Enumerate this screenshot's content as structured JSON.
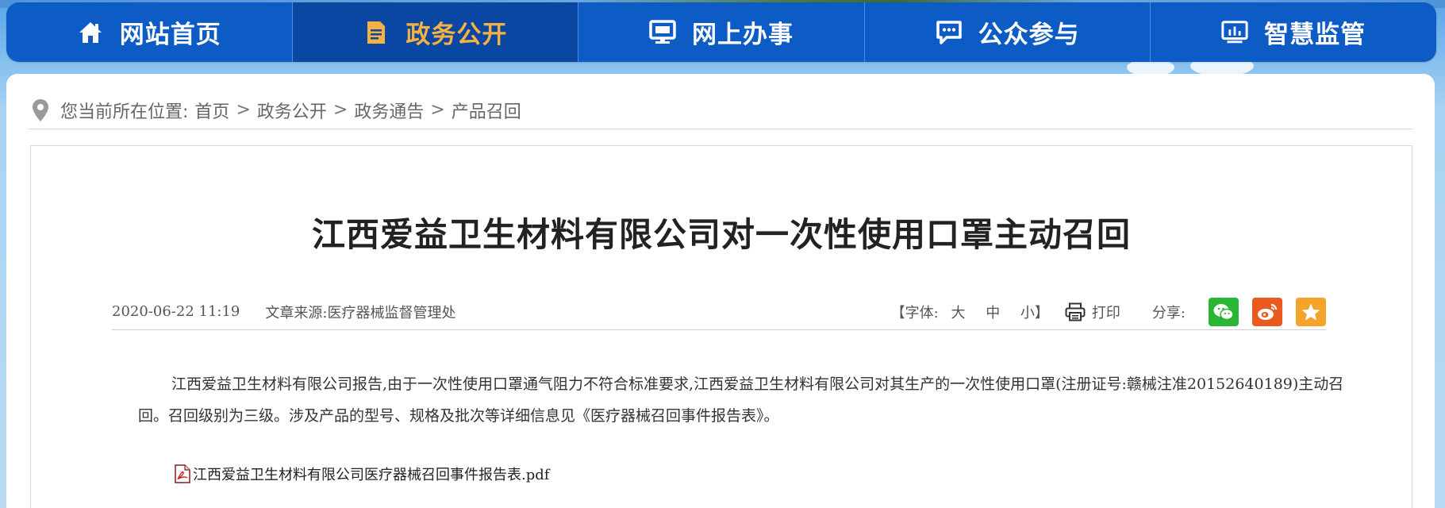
{
  "nav": {
    "items": [
      {
        "label": "网站首页",
        "icon": "home-icon"
      },
      {
        "label": "政务公开",
        "icon": "document-icon",
        "active": true
      },
      {
        "label": "网上办事",
        "icon": "monitor-icon"
      },
      {
        "label": "公众参与",
        "icon": "chat-icon"
      },
      {
        "label": "智慧监管",
        "icon": "dashboard-icon"
      }
    ],
    "active_color": "#f5b142",
    "bg_color": "#0d5bc5"
  },
  "breadcrumb": {
    "prefix": "您当前所在位置:",
    "items": [
      "首页",
      "政务公开",
      "政务通告",
      "产品召回"
    ],
    "separator": ">"
  },
  "article": {
    "title": "江西爱益卫生材料有限公司对一次性使用口罩主动召回",
    "date": "2020-06-22 11:19",
    "source": "文章来源:医疗器械监督管理处",
    "font_label": "【字体:",
    "font_large": "大",
    "font_medium": "中",
    "font_small": "小】",
    "print_label": "打印",
    "share_label": "分享:",
    "share_icons": [
      "wechat-icon",
      "weibo-icon",
      "favorite-icon"
    ],
    "body": "江西爱益卫生材料有限公司报告,由于一次性使用口罩通气阻力不符合标准要求,江西爱益卫生材料有限公司对其生产的一次性使用口罩(注册证号:赣械注准20152640189)主动召回。召回级别为三级。涉及产品的型号、规格及批次等详细信息见《医疗器械召回事件报告表》。",
    "attachment": "江西爱益卫生材料有限公司医疗器械召回事件报告表.pdf"
  }
}
